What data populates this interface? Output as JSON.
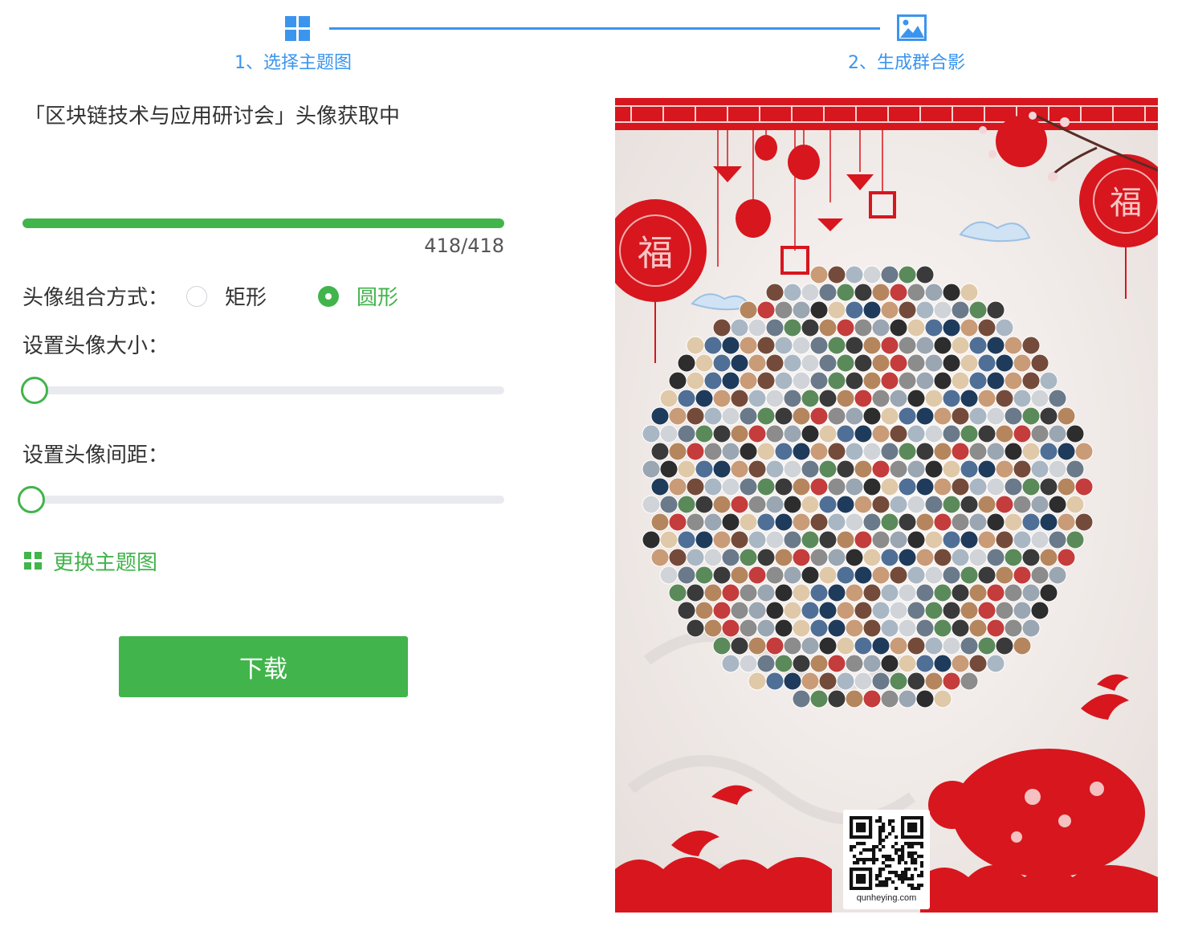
{
  "stepper": {
    "step1": {
      "label": "1、选择主题图",
      "icon": "grid-icon"
    },
    "step2": {
      "label": "2、生成群合影",
      "icon": "image-icon"
    }
  },
  "status": {
    "title": "「区块链技术与应用研讨会」头像获取中"
  },
  "progress": {
    "current": 418,
    "total": 418,
    "text": "418/418",
    "fraction": 1.0
  },
  "combo": {
    "label": "头像组合方式：",
    "options": [
      {
        "label": "矩形",
        "checked": false
      },
      {
        "label": "圆形",
        "checked": true
      }
    ]
  },
  "avatar_size": {
    "label": "设置头像大小：",
    "value": 0
  },
  "avatar_spacing": {
    "label": "设置头像间距：",
    "value": 0
  },
  "change_theme": {
    "label": "更换主题图"
  },
  "download": {
    "label": "下载"
  },
  "poster": {
    "lantern_char": "福",
    "domain": "qunheying.com"
  },
  "colors": {
    "accent_blue": "#3b95ee",
    "accent_green": "#41b44b",
    "festive_red": "#d7161e"
  }
}
